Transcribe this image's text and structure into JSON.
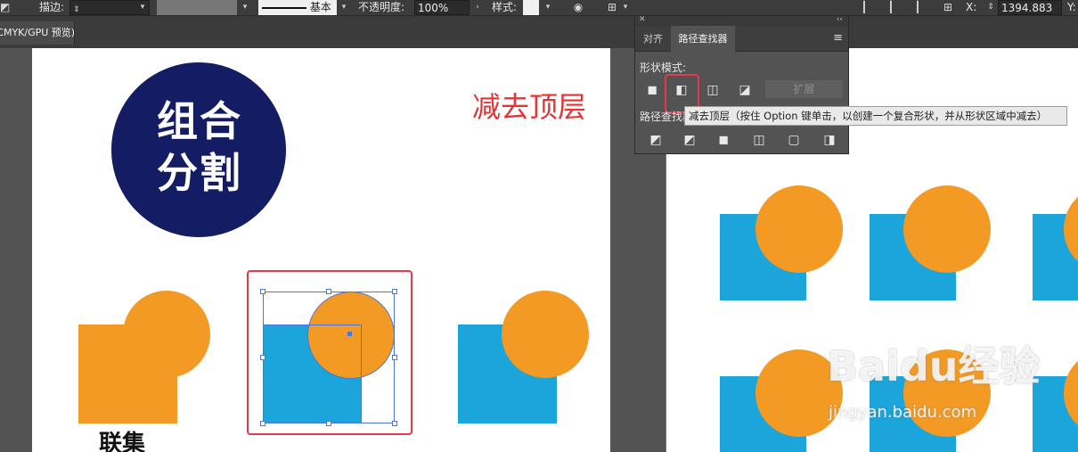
{
  "control_bar": {
    "stroke_label": "描边:",
    "stroke_style_label": "基本",
    "opacity_label": "不透明度:",
    "opacity_value": "100%",
    "style_label": "样式:",
    "x_label": "X:",
    "x_value": "1394.883",
    "y_label": "Y:"
  },
  "document_tab": {
    "label": "(CMYK/GPU 预览)"
  },
  "artboard_left": {
    "logo_line1": "组合",
    "logo_line2": "分割",
    "title": "减去顶层",
    "caption": "联集"
  },
  "panel": {
    "tabs": [
      "对齐",
      "路径查找器"
    ],
    "active_tab": "路径查找器",
    "shape_modes_label": "形状模式:",
    "pathfinders_label": "路径查找器:",
    "expand_label": "扩展"
  },
  "tooltip": {
    "text": "减去顶层（按住 Option 键单击，以创建一个复合形状，并从形状区域中减去）"
  },
  "watermark": {
    "brand": "Baidu经验",
    "url": "jingyan.baidu.com"
  },
  "colors": {
    "orange": "#F39A24",
    "blue": "#1BA5DB",
    "navy": "#141D64",
    "red": "#E83232",
    "highlight": "#E63A4B"
  }
}
